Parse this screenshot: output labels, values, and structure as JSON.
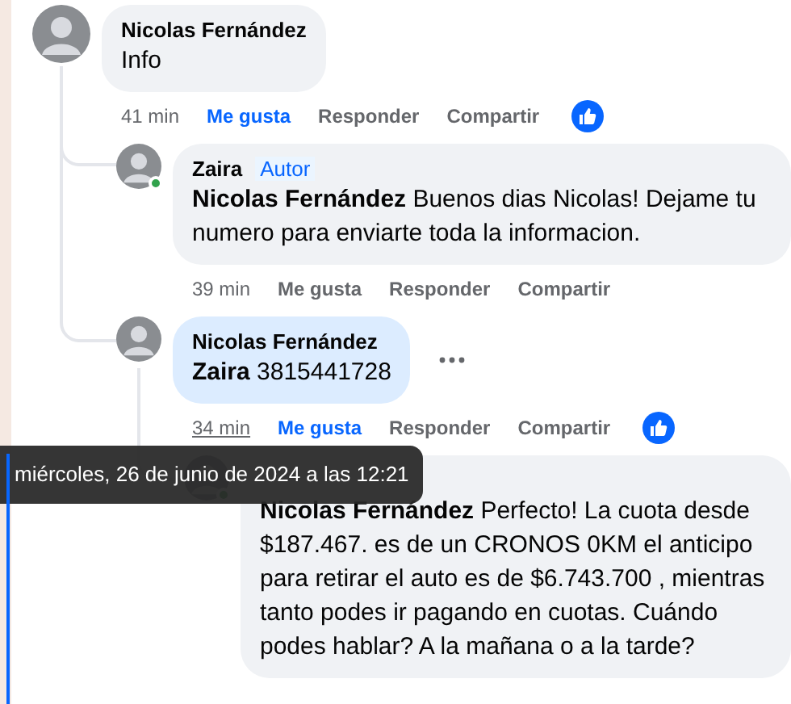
{
  "comments": [
    {
      "author": "Nicolas Fernández",
      "text": "Info",
      "selected": false,
      "time": "41 min",
      "time_hovered": false,
      "actions": [
        {
          "label": "Me gusta",
          "selected": true
        },
        {
          "label": "Responder",
          "selected": false
        },
        {
          "label": "Compartir",
          "selected": false
        }
      ],
      "like_reaction": true,
      "children": [
        {
          "author": "Zaira",
          "author_badge": "Autor",
          "text": "**Nicolas Fernández** Buenos dias Nicolas! Dejame tu numero para enviarte toda la informacion.",
          "online": true,
          "selected": false,
          "time": "39 min",
          "time_hovered": false,
          "actions": [
            {
              "label": "Me gusta",
              "selected": false
            },
            {
              "label": "Responder",
              "selected": false
            },
            {
              "label": "Compartir",
              "selected": false
            }
          ]
        },
        {
          "author": "Nicolas Fernández",
          "text": "**Zaira** 3815441728",
          "selected": true,
          "time": "34 min",
          "time_hovered": true,
          "actions": [
            {
              "label": "Me gusta",
              "selected": true
            },
            {
              "label": "Responder",
              "selected": false
            },
            {
              "label": "Compartir",
              "selected": false
            }
          ],
          "like_reaction": true,
          "more_menu": true,
          "children": [
            {
              "text": "**Nicolas Fernández** Perfecto! La cuota desde $187.467. es de un CRONOS 0KM el anticipo para retirar el auto es de $6.743.700 , mientras tanto podes ir pagando en cuotas. Cuándo podes hablar? A la mañana o a la tarde?",
              "online": true,
              "selected": false
            }
          ]
        }
      ]
    }
  ],
  "tooltip": {
    "text": "miércoles, 26 de junio de 2024 a las 12:21"
  }
}
